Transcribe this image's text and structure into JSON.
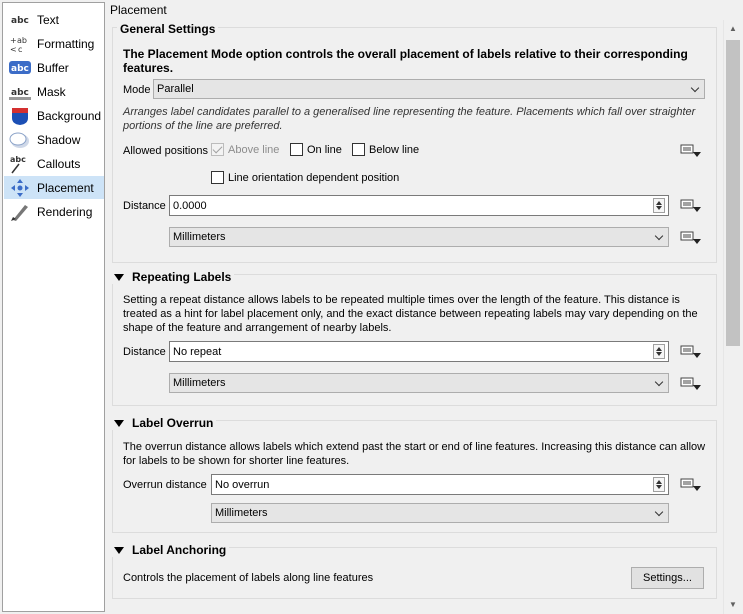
{
  "sidebar": {
    "items": [
      {
        "label": "Text",
        "icon": "abc-text-icon"
      },
      {
        "label": "Formatting",
        "icon": "formatting-icon"
      },
      {
        "label": "Buffer",
        "icon": "buffer-icon"
      },
      {
        "label": "Mask",
        "icon": "mask-icon"
      },
      {
        "label": "Background",
        "icon": "background-icon"
      },
      {
        "label": "Shadow",
        "icon": "shadow-icon"
      },
      {
        "label": "Callouts",
        "icon": "callouts-icon"
      },
      {
        "label": "Placement",
        "icon": "placement-icon"
      },
      {
        "label": "Rendering",
        "icon": "rendering-icon"
      }
    ],
    "selected": "Placement",
    "selected_color": "#cde3f7"
  },
  "main": {
    "title": "Placement",
    "general": {
      "title": "General Settings",
      "intro": "The Placement Mode option controls the overall placement of labels relative to their corresponding features.",
      "mode_label": "Mode",
      "mode_value": "Parallel",
      "mode_description": "Arranges label candidates parallel to a generalised line representing the feature. Placements which fall over straighter portions of the line are preferred.",
      "allowed_label": "Allowed positions",
      "above_line": "Above line",
      "on_line": "On line",
      "below_line": "Below line",
      "line_orientation": "Line orientation dependent position",
      "distance_label": "Distance",
      "distance_value": "0.0000",
      "units_value": "Millimeters"
    },
    "repeating": {
      "title": "Repeating Labels",
      "description": "Setting a repeat distance allows labels to be repeated multiple times over the length of the feature. This distance is treated as a hint for label placement only, and the exact distance between repeating labels may vary depending on the shape of the feature and arrangement of nearby labels.",
      "distance_label": "Distance",
      "distance_value": "No repeat",
      "units_value": "Millimeters"
    },
    "overrun": {
      "title": "Label Overrun",
      "description": "The overrun distance allows labels which extend past the start or end of line features. Increasing this distance can allow for labels to be shown for shorter line features.",
      "distance_label": "Overrun distance",
      "distance_value": "No overrun",
      "units_value": "Millimeters"
    },
    "anchoring": {
      "title": "Label Anchoring",
      "description": "Controls the placement of labels along line features",
      "settings_button": "Settings..."
    }
  }
}
